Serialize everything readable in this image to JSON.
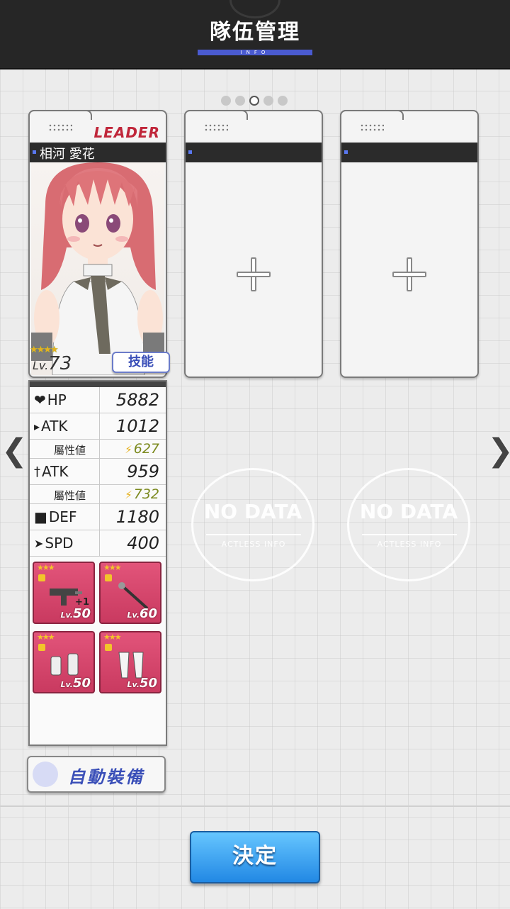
{
  "header": {
    "title": "隊伍管理",
    "subtitle": "INFO"
  },
  "pager": {
    "total": 5,
    "active_index": 2
  },
  "leader_card": {
    "badge": "LEADER",
    "name": "相河 愛花",
    "stars": "★★★★",
    "level_prefix": "Lv.",
    "level": "73",
    "skill_label": "技能"
  },
  "stats": [
    {
      "icon": "heart-icon",
      "label": "HP",
      "value": "5882"
    },
    {
      "icon": "gun-icon",
      "label": "ATK",
      "value": "1012"
    },
    {
      "icon": "bolt-icon",
      "label": "屬性値",
      "value": "627",
      "sub": true
    },
    {
      "icon": "sword-icon",
      "label": "ATK",
      "value": "959"
    },
    {
      "icon": "bolt-icon",
      "label": "屬性値",
      "value": "732",
      "sub": true
    },
    {
      "icon": "shield-icon",
      "label": "DEF",
      "value": "1180"
    },
    {
      "icon": "wing-icon",
      "label": "SPD",
      "value": "400"
    }
  ],
  "equipment": [
    {
      "name": "gun",
      "stars": "★★★",
      "level_prefix": "Lv.",
      "level": "50",
      "bonus": "+1"
    },
    {
      "name": "staff",
      "stars": "★★★",
      "level_prefix": "Lv.",
      "level": "60"
    },
    {
      "name": "gauntlets",
      "stars": "★★★",
      "level_prefix": "Lv.",
      "level": "50"
    },
    {
      "name": "boots",
      "stars": "★★★",
      "level_prefix": "Lv.",
      "level": "50"
    }
  ],
  "auto_equip_label": "自動裝備",
  "nodata": {
    "title": "NO DATA",
    "subtitle": "ACTLESS INFO"
  },
  "confirm_label": "決定",
  "colors": {
    "accent": "#4a5bd1",
    "leader": "#c0263a",
    "confirm": "#2288e4",
    "equip_bg": "#d24468"
  }
}
